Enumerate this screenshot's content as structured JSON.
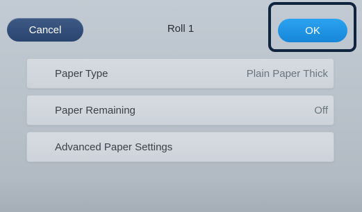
{
  "header": {
    "cancel_label": "Cancel",
    "title": "Roll 1",
    "ok_label": "OK"
  },
  "settings": [
    {
      "label": "Paper Type",
      "value": "Plain Paper Thick"
    },
    {
      "label": "Paper Remaining",
      "value": "Off"
    },
    {
      "label": "Advanced Paper Settings",
      "value": ""
    }
  ],
  "colors": {
    "cancel_button": "#2f4a78",
    "ok_button": "#1e93e6",
    "highlight_frame": "#10243d",
    "panel_background": "#bfc7d0"
  }
}
